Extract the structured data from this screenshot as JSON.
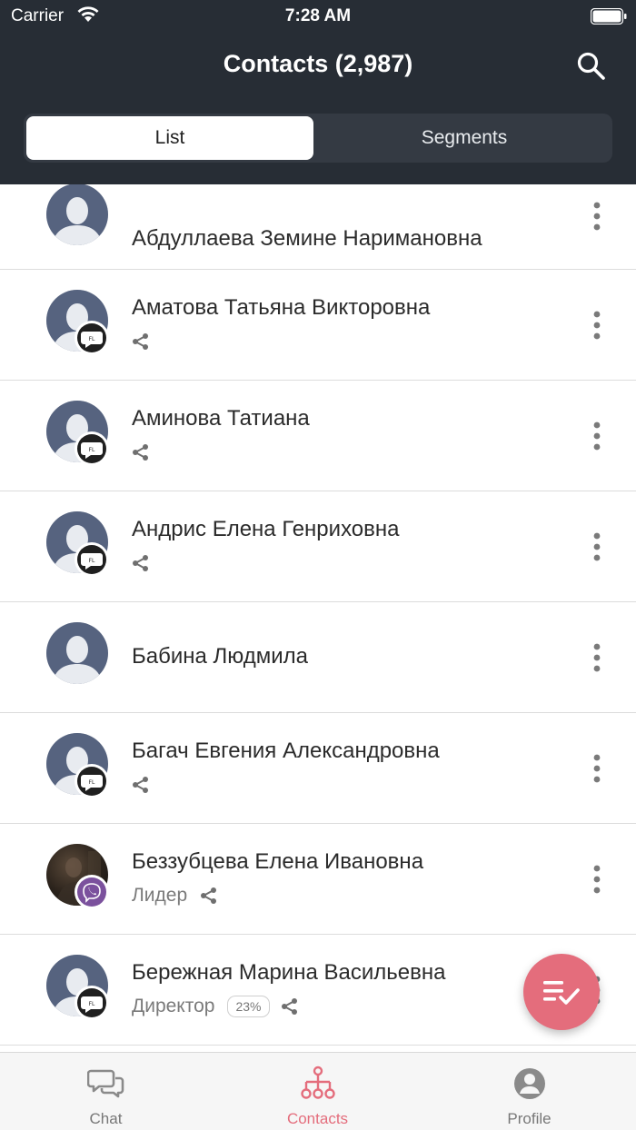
{
  "status_bar": {
    "carrier": "Carrier",
    "time": "7:28 AM"
  },
  "header": {
    "title": "Contacts (2,987)"
  },
  "segments": {
    "list": "List",
    "segments": "Segments",
    "selected": "List"
  },
  "contacts": [
    {
      "name": "Абдуллаева Земине Наримановна",
      "badge": "",
      "role": "",
      "percent": "",
      "shared": false
    },
    {
      "name": "Аматова Татьяна Викторовна",
      "badge": "FL",
      "role": "",
      "percent": "",
      "shared": true
    },
    {
      "name": "Аминова Татиана",
      "badge": "FL",
      "role": "",
      "percent": "",
      "shared": true
    },
    {
      "name": "Андрис Елена Генриховна",
      "badge": "FL",
      "role": "",
      "percent": "",
      "shared": true
    },
    {
      "name": "Бабина Людмила",
      "badge": "",
      "role": "",
      "percent": "",
      "shared": false
    },
    {
      "name": "Багач Евгения Александровна",
      "badge": "FL",
      "role": "",
      "percent": "",
      "shared": true
    },
    {
      "name": "Беззубцева Елена Ивановна",
      "badge": "viber-icon",
      "role": "Лидер",
      "percent": "",
      "shared": true
    },
    {
      "name": "Бережная Марина Васильевна",
      "badge": "FL",
      "role": "Директор",
      "percent": "23%",
      "shared": true
    }
  ],
  "tabbar": {
    "chat": "Chat",
    "contacts": "Contacts",
    "profile": "Profile",
    "active": "Contacts"
  },
  "colors": {
    "header_bg": "#272d35",
    "accent": "#e46d7c",
    "avatar_silhouette": "#56637f",
    "viber": "#7b519d"
  }
}
